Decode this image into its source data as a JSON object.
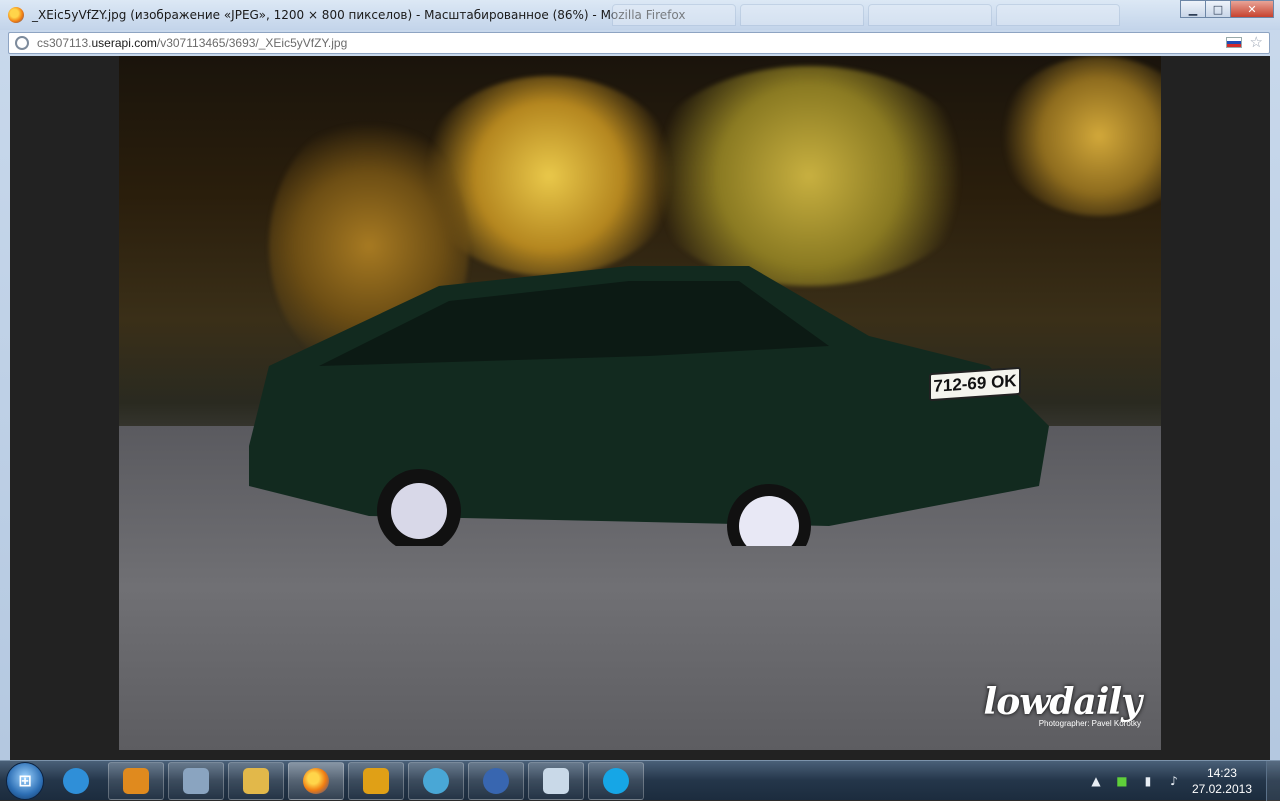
{
  "window": {
    "title": "_XEic5yVfZY.jpg (изображение «JPEG», 1200 × 800 пикселов) - Масштабированное (86%) - Mozilla Firefox",
    "minimize": "▁",
    "maximize": "□",
    "close": "✕"
  },
  "urlbar": {
    "url_prefix": "cs307113.",
    "url_host": "userapi.com",
    "url_path": "/v307113465/3693/_XEic5yVfZY.jpg"
  },
  "image": {
    "plate_text": "712-69 OK",
    "watermark_logo": "lowdaily",
    "watermark_credit": "Photographer: Pavel Korotky"
  },
  "taskbar": {
    "start_label": "⊞",
    "apps": [
      {
        "icon": "internet-explorer-icon",
        "color": "#2f8fd8"
      },
      {
        "icon": "media-player-icon",
        "color": "#e08a1e"
      },
      {
        "icon": "calculator-icon",
        "color": "#8aa4c0"
      },
      {
        "icon": "explorer-folder-icon",
        "color": "#e2b84a"
      },
      {
        "icon": "firefox-icon",
        "color": "#f07c12"
      },
      {
        "icon": "game-icon",
        "color": "#e0a016"
      },
      {
        "icon": "network-icon",
        "color": "#49a7d6"
      },
      {
        "icon": "thunderbird-icon",
        "color": "#3866b0"
      },
      {
        "icon": "paint-icon",
        "color": "#c9d9e8"
      },
      {
        "icon": "skype-icon",
        "color": "#16a6e6"
      }
    ],
    "clock_time": "14:23",
    "clock_date": "27.02.2013"
  }
}
